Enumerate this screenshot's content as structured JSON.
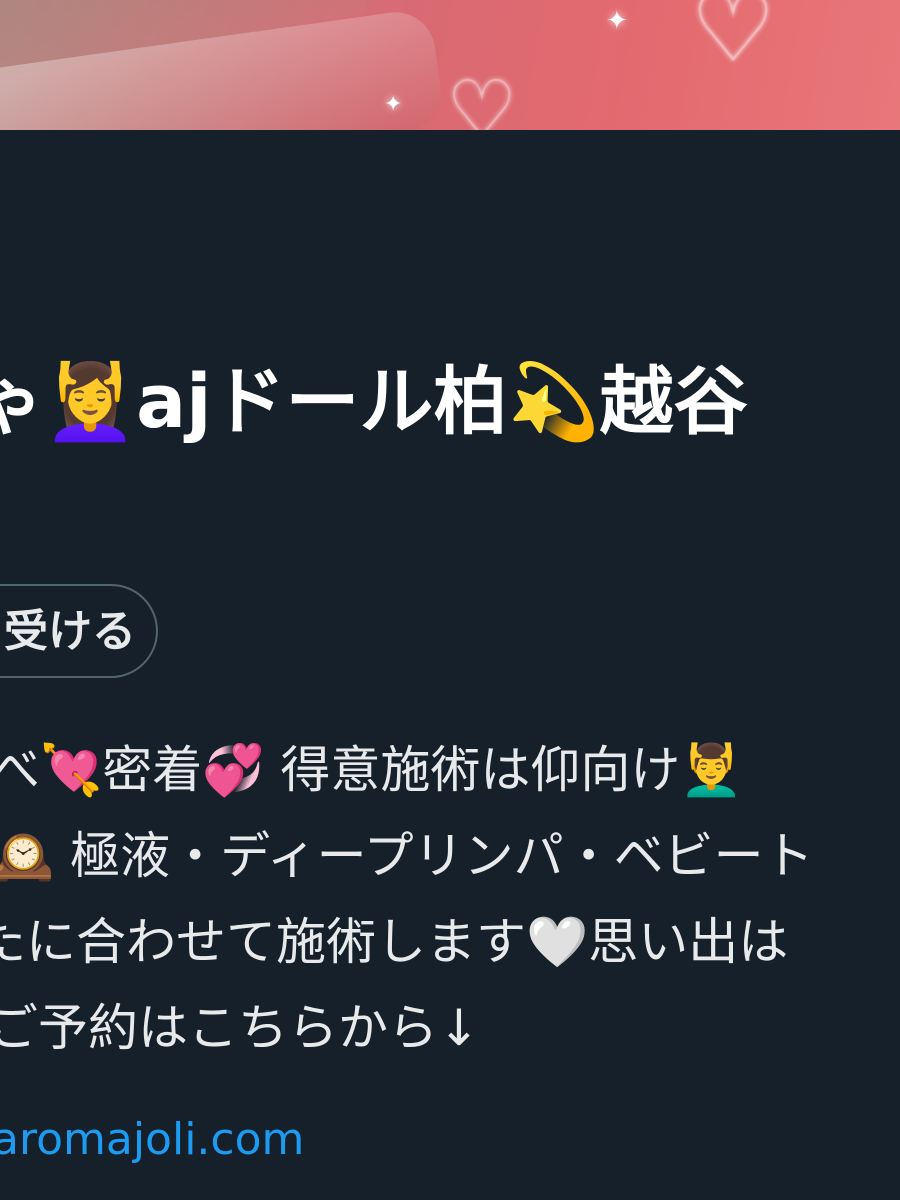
{
  "profile": {
    "display_name": "ゃ💆‍♀️ajドール柏💫越谷",
    "follow_button_label": "受ける",
    "bio_lines": [
      "べ💘密着💞 得意施術は仰向け💆‍♂️",
      "🕰️ 極液・ディープリンパ・ベビート",
      "たに合わせて施術します🤍思い出は",
      "ご予約はこちらから↓"
    ],
    "link_text": "aromajoli.com"
  },
  "colors": {
    "background": "#15202b",
    "text": "#e7e9ea",
    "link": "#1d9bf0",
    "pill_border": "#536471"
  },
  "banner": {
    "sparkle_glyph": "✦",
    "heart_glyph": "♡"
  }
}
